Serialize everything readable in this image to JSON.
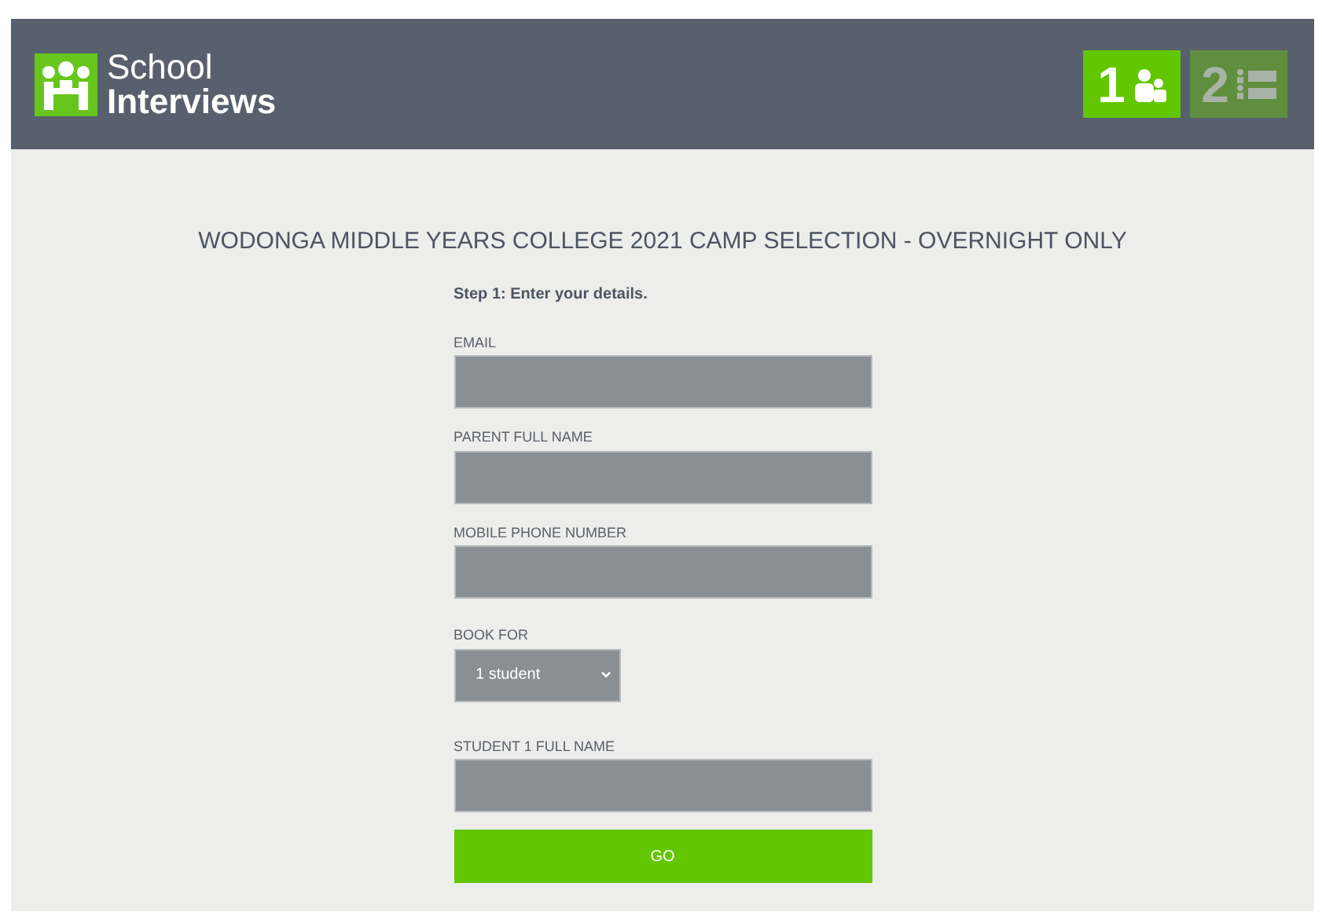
{
  "header": {
    "logo": {
      "line_1": "School",
      "line_2": "Interviews"
    },
    "steps": [
      {
        "number": "1",
        "selected": true
      },
      {
        "number": "2",
        "selected": false
      }
    ]
  },
  "title": "WODONGA MIDDLE YEARS COLLEGE 2021 CAMP SELECTION - OVERNIGHT ONLY",
  "step_label": "Step 1: Enter your details.",
  "fields": [
    {
      "kind": "text",
      "label": "EMAIL"
    },
    {
      "kind": "text",
      "label": "PARENT FULL NAME"
    },
    {
      "kind": "text",
      "label": "MOBILE PHONE NUMBER"
    },
    {
      "kind": "select",
      "label": "BOOK FOR",
      "value": "1 student"
    },
    {
      "kind": "text",
      "label": "STUDENT 1 FULL NAME"
    }
  ],
  "submit": "GO"
}
